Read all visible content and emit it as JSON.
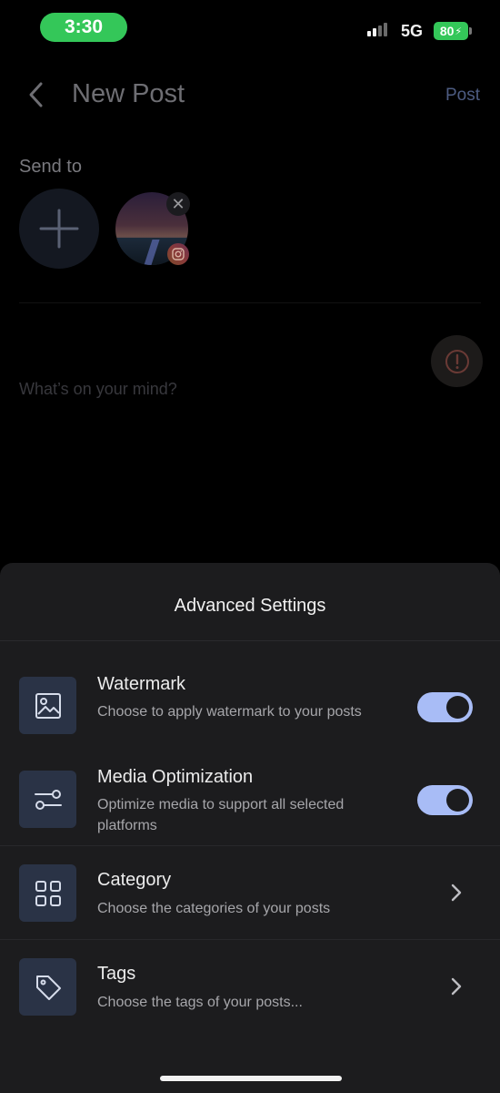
{
  "status_bar": {
    "time": "3:30",
    "network": "5G",
    "battery": "80"
  },
  "header": {
    "title": "New Post",
    "post_label": "Post"
  },
  "compose": {
    "send_to_label": "Send to",
    "placeholder": "What’s on your mind?"
  },
  "sheet": {
    "title": "Advanced Settings",
    "items": [
      {
        "title": "Watermark",
        "description": "Choose to apply watermark to your posts",
        "icon": "image-icon",
        "control": "toggle",
        "enabled": true
      },
      {
        "title": "Media Optimization",
        "description": "Optimize media to support all selected platforms",
        "icon": "sliders-icon",
        "control": "toggle",
        "enabled": true
      },
      {
        "title": "Category",
        "description": "Choose the categories of your posts",
        "icon": "grid-icon",
        "control": "chevron"
      },
      {
        "title": "Tags",
        "description": "Choose the tags of your posts...",
        "icon": "tag-icon",
        "control": "chevron"
      }
    ]
  },
  "colors": {
    "status_green": "#34c759",
    "toggle_on": "#a8bcf6",
    "sheet_bg": "#1c1c1e",
    "icon_tile_bg": "#2a3346"
  }
}
